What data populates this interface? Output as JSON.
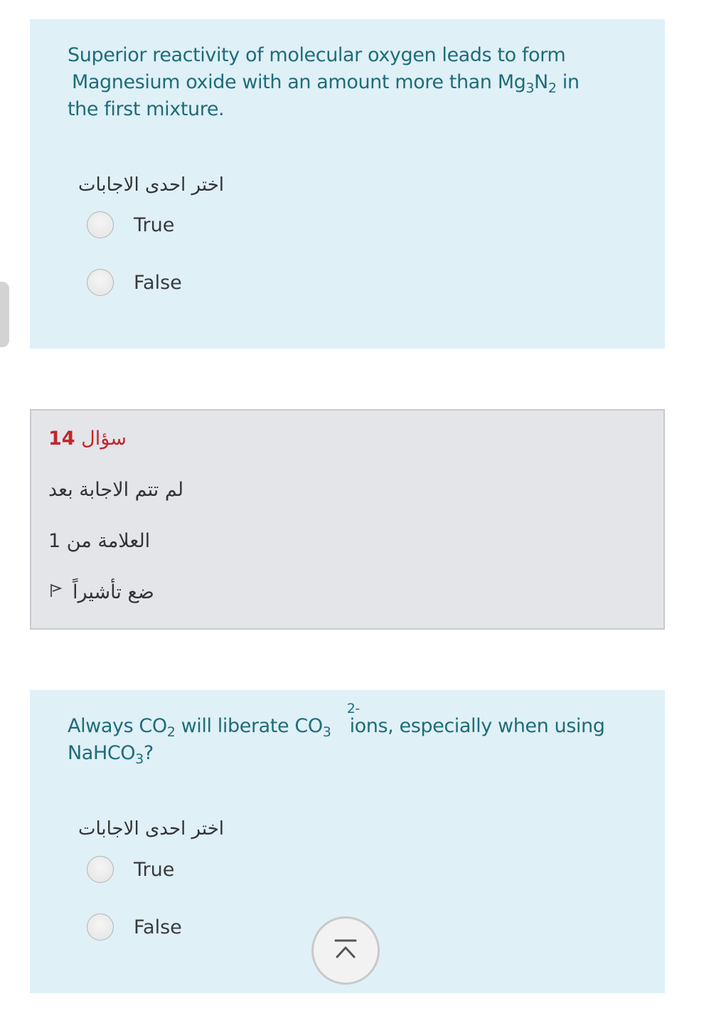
{
  "question_1": {
    "text_parts": [
      "Superior reactivity of molecular oxygen leads to form",
      "Magnesium oxide with an amount more than Mg",
      "3",
      "N",
      "2",
      " in",
      "the first mixture."
    ],
    "prompt": "اختر احدى الاجابات",
    "options": [
      {
        "label": "True",
        "selected": false
      },
      {
        "label": "False",
        "selected": false
      }
    ]
  },
  "question_info": {
    "label": "سؤال",
    "number": "14",
    "status": "لم تتم الاجابة بعد",
    "marks": "العلامة من 1",
    "flag_label": "ضع تأشيراً",
    "flag_icon": "flag-icon"
  },
  "question_2": {
    "text_parts": [
      "Always CO",
      "2",
      " will liberate CO",
      "3",
      "2-",
      " ions, especially when using",
      "NaHCO",
      "3",
      "?"
    ],
    "prompt": "اختر احدى الاجابات",
    "options": [
      {
        "label": "True",
        "selected": false
      },
      {
        "label": "False",
        "selected": false
      }
    ]
  },
  "scroll_button": {
    "icon": "scroll-to-top-icon"
  },
  "colors": {
    "card_background": "#dff0f7",
    "question_text": "#1f6c78",
    "question_number": "#c0272d",
    "info_background": "#e3e5e9"
  }
}
